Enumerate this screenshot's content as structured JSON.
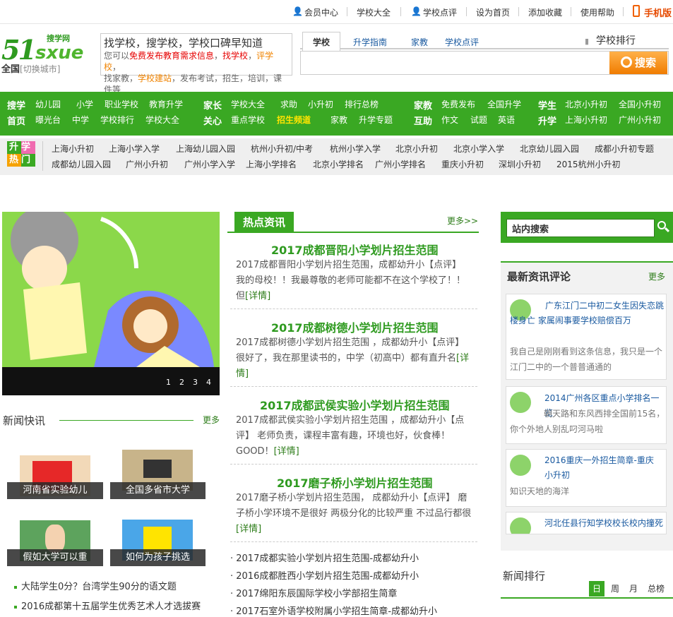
{
  "topbar": {
    "member": "会员中心",
    "schools": "学校大全",
    "review": "学校点评",
    "homepage": "设为首页",
    "favorite": "添加收藏",
    "help": "使用帮助",
    "mobile": "手机版"
  },
  "logo": {
    "num": "51",
    "sx": "sxue",
    "cn": "搜学网"
  },
  "city": {
    "name": "全国",
    "switch": "[切换城市]"
  },
  "slogan": {
    "title": "找学校，搜学校，学校口碑早知道",
    "l1a": "您可以",
    "l1b": "免费发布教育需求信息",
    "l1c": "，",
    "l1d": "找学校",
    "l1e": "，",
    "l1f": "评学校",
    "l1g": "，",
    "l2a": "找家教",
    "l2b": "，",
    "l2c": "学校建站",
    "l2d": "，发布考试，招生，培训，课件等"
  },
  "search": {
    "tabs": [
      "学校",
      "升学指南",
      "家教",
      "学校点评"
    ],
    "button": "搜索",
    "rank": "学校排行"
  },
  "gnav": {
    "c1": {
      "h1": "搜学",
      "h2": "首页",
      "r1": [
        "幼儿园",
        "小学",
        "职业学校",
        "教育升学"
      ],
      "r2": [
        "曝光台",
        "中学",
        "学校排行",
        "学校大全"
      ]
    },
    "c2": {
      "h1": "家长",
      "h2": "关心",
      "r1": [
        "学校大全",
        "求助",
        "小升初",
        "排行总榜"
      ],
      "r2": [
        "重点学校",
        "招生频道",
        "家教",
        "升学专题"
      ]
    },
    "c3": {
      "h1": "家教",
      "h2": "互助",
      "r1": [
        "免费发布",
        "全国升学"
      ],
      "r2": [
        "作文",
        "试题",
        "英语"
      ]
    },
    "c4": {
      "h1": "学生",
      "h2": "升学",
      "r1": [
        "北京小升初",
        "全国小升初"
      ],
      "r2": [
        "上海小升初",
        "广州小升初"
      ]
    }
  },
  "hot": {
    "logo1": "升学",
    "logo2": "热门",
    "r1": [
      "上海小升初",
      "上海小学入学",
      "上海幼儿园入园",
      "杭州小升初/中考",
      "杭州小学入学",
      "北京小升初",
      "北京小学入学",
      "北京幼儿园入园",
      "成都小升初专题"
    ],
    "r2": [
      "成都幼儿园入园",
      "广州小升初",
      "广州小学入学",
      "上海小学排名",
      "北京小学排名",
      "广州小学排名",
      "重庆小升初",
      "深圳小升初",
      "2015杭州小升初"
    ]
  },
  "slider": {
    "dots": [
      "1",
      "2",
      "3",
      "4"
    ]
  },
  "flash": {
    "title": "新闻快讯",
    "more": "更多",
    "items": [
      "河南省实验幼儿",
      "全国多省市大学",
      "假如大学可以重",
      "如何为孩子挑选"
    ],
    "list": [
      "大陆学生0分？台湾学生90分的语文题",
      "2016成都第十五届学生优秀艺术人才选拔赛"
    ]
  },
  "hotnews": {
    "tab": "热点资讯",
    "more": "更多>>",
    "detail": "[详情]",
    "items": [
      {
        "title": "2017成都晋阳小学划片招生范围",
        "body": "2017成都晋阳小学划片招生范围，成都幼升小【点评】 我的母校！！我最尊敬的老师可能都不在这个学校了！！但"
      },
      {
        "title": "2017成都树德小学划片招生范围",
        "body": "2017成都树德小学划片招生范围 ，成都幼升小【点评】 很好了，我在那里读书的，中学（初高中）都有直升名"
      },
      {
        "title": "2017成都武侯实验小学划片招生范围",
        "body": "2017成都武侯实验小学划片招生范围 ，成都幼升小【点评】 老师负责，课程丰富有趣，环境也好，伙食棒！GOOD！"
      },
      {
        "title": "2017磨子桥小学划片招生范围",
        "body": "2017磨子桥小学划片招生范围， 成都幼升小【点评】 磨子桥小学环境不是很好 两极分化的比较严重 不过品行都很"
      }
    ],
    "list": [
      "2017成都实验小学划片招生范围-成都幼升小",
      "2016成都胜西小学划片招生范围-成都幼升小",
      "2017绵阳东辰国际学校小学部招生简章",
      "2017石室外语学校附属小学招生简章-成都幼升小"
    ]
  },
  "right": {
    "search": "站内搜索",
    "comments_title": "最新资讯评论",
    "more": "更多",
    "comments": [
      {
        "title": "广东江门二中初二女生因失恋跳楼身亡 家属闹事要学校赔偿百万",
        "body": "我自己是刚刚看到这条信息，我只是一个江门二中的一个普普通通的"
      },
      {
        "title": "2014广州各区重点小学排名一览",
        "body": "朝天路和东风西排全国前15名，你个外地人别乱叼河马啦"
      },
      {
        "title": "2016重庆一外招生简章-重庆小升初",
        "body": "知识天地的海洋"
      },
      {
        "title": "河北任县行知学校校长校内撞死",
        "body": ""
      }
    ],
    "rank_title": "新闻排行",
    "rank_tabs": [
      "日",
      "周",
      "月",
      "总榜"
    ]
  },
  "colors": {
    "green": "#3aa823",
    "orange": "#f08300",
    "red": "#e60000"
  }
}
